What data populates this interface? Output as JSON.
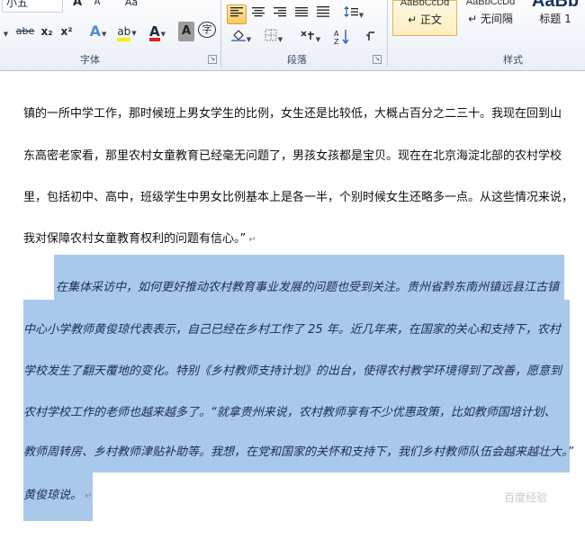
{
  "ribbon": {
    "font_group": {
      "label": "字体",
      "font_name": "小五",
      "strike_text": "abe",
      "subscript": "x₂",
      "superscript": "x²",
      "grow_label": "A",
      "shrink_label": "A",
      "case_label": "Aa",
      "text_effect_label": "A",
      "highlight_label": "ab",
      "font_color_label": "A",
      "char_shading_label": "A",
      "enclose_label": "字"
    },
    "paragraph_group": {
      "label": "段落",
      "sort_label": "A↓Z"
    },
    "styles_group": {
      "label": "样式",
      "styles": [
        {
          "sample": "AaBbCcDd",
          "name": "↵ 正文",
          "selected": true
        },
        {
          "sample": "AaBbCcDd",
          "name": "↵ 无间隔",
          "selected": false
        },
        {
          "sample": "AaBb",
          "name": "标题 1",
          "selected": false
        }
      ]
    }
  },
  "document": {
    "lines": [
      "镇的一所中学工作，那时候班上男女学生的比例，女生还是比较低，大概占百分之二三十。我现在回到山",
      "东高密老家看，那里农村女童教育已经毫无问题了，男孩女孩都是宝贝。现在在北京海淀北部的农村学校",
      "里，包括初中、高中，班级学生中男女比例基本上是各一半，个别时候女生还略多一点。从这些情况来说，",
      "我对保障农村女童教育权利的问题有信心。”"
    ],
    "selected_lines": [
      "在集体采访中，如何更好推动农村教育事业发展的问题也受到关注。贵州省黔东南州镇远县江古镇",
      "中心小学教师黄俊琼代表表示，自己已经在乡村工作了 25 年。近几年来，在国家的关心和支持下，农村",
      "学校发生了翻天覆地的变化。特别《乡村教师支持计划》的出台，使得农村教学环境得到了改善，愿意到",
      "农村学校工作的老师也越来越多了。“就拿贵州来说，农村教师享有不少优惠政策，比如教师国培计划、",
      "教师周转房、乡村教师津贴补助等。我想，在党和国家的关怀和支持下，我们乡村教师队伍会越来越壮大。”",
      "黄俊琼说。"
    ],
    "paragraph_mark": "↵"
  },
  "watermark": "百度经验"
}
